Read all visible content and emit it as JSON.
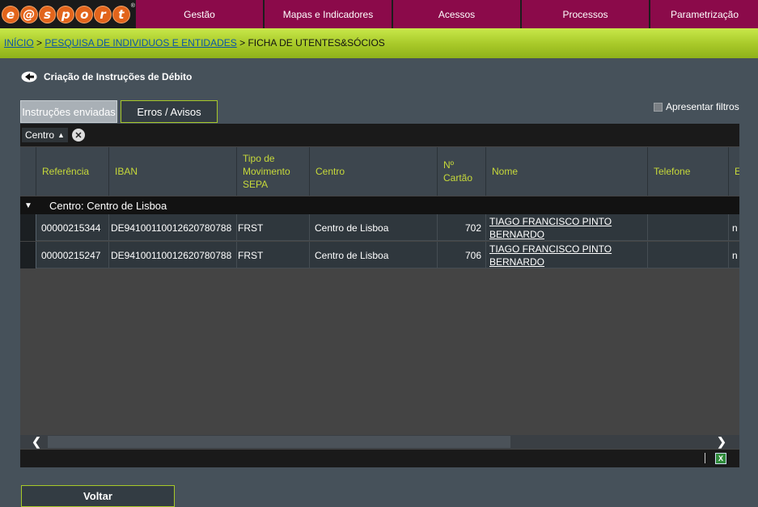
{
  "logo": {
    "letters": [
      "e",
      "@",
      "s",
      "p",
      "o",
      "r",
      "t"
    ],
    "reg": "®"
  },
  "menu": [
    "Gestão",
    "Mapas e Indicadores",
    "Acessos",
    "Processos",
    "Parametrização"
  ],
  "breadcrumb": {
    "home": "INÍCIO",
    "sep1": " > ",
    "search": "PESQUISA DE INDIVIDUOS E ENTIDADES",
    "sep2": " > ",
    "current": "FICHA DE UTENTES&SÓCIOS"
  },
  "page_title": "Criação de Instruções de Débito",
  "tabs": {
    "sent": "Instruções enviadas",
    "errors": "Erros / Avisos"
  },
  "filters_label": "Apresentar filtros",
  "group_chip": "Centro",
  "columns": {
    "referencia": "Referência",
    "iban": "IBAN",
    "tipo_l1": "Tipo de",
    "tipo_l2": "Movimento",
    "tipo_l3": "SEPA",
    "centro": "Centro",
    "cartao_l1": "Nº",
    "cartao_l2": "Cartão",
    "nome": "Nome",
    "telefone": "Telefone",
    "extra": "E"
  },
  "group_row": "Centro: Centro de Lisboa",
  "rows": [
    {
      "referencia": "00000215344",
      "iban": "DE94100110012620780788",
      "tipo": "FRST",
      "centro": "Centro de Lisboa",
      "cartao": "702",
      "nome": "TIAGO FRANCISCO PINTO BERNARDO",
      "telefone": "",
      "extra": "n"
    },
    {
      "referencia": "00000215247",
      "iban": "DE94100110012620780788",
      "tipo": "FRST",
      "centro": "Centro de Lisboa",
      "cartao": "706",
      "nome": "TIAGO FRANCISCO PINTO BERNARDO",
      "telefone": "",
      "extra": "n"
    }
  ],
  "scroll": {
    "left": "❮",
    "right": "❯"
  },
  "footer_sep": "|",
  "excel_icon": "X",
  "back_button": "Voltar",
  "colors": {
    "menu": "#8b0a4a",
    "accent": "#a7c828",
    "column_header": "#c7d93a"
  }
}
